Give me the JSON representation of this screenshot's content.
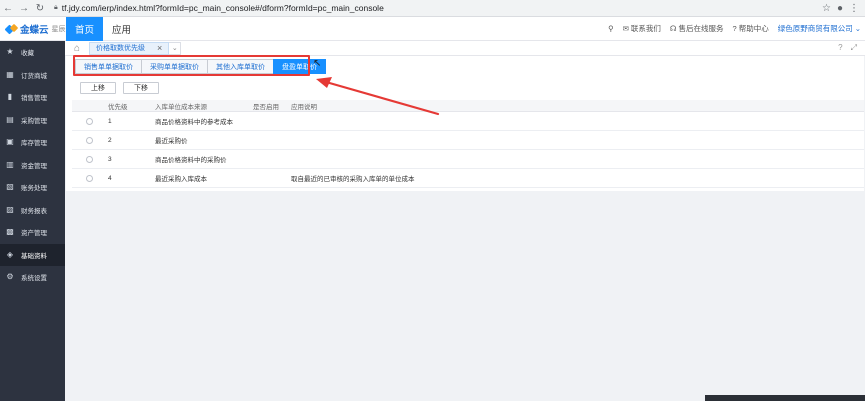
{
  "browser": {
    "url": "tf.jdy.com/ierp/index.html?formId=pc_main_console#/dform?formId=pc_main_console"
  },
  "header": {
    "logo_text": "金蝶云",
    "logo_sub": "星辰",
    "tabs": [
      {
        "label": "首页",
        "active": true
      },
      {
        "label": "应用",
        "active": false
      }
    ],
    "links": {
      "contact": "联系我们",
      "service": "售后在线服务",
      "help": "帮助中心",
      "company": "绿色原野商贸有限公司"
    }
  },
  "sidebar": {
    "items": [
      {
        "label": "收藏",
        "icon": "star-icon"
      },
      {
        "label": "订货商城",
        "icon": "mall-icon"
      },
      {
        "label": "销售管理",
        "icon": "bar-chart-icon"
      },
      {
        "label": "采购管理",
        "icon": "purchase-icon"
      },
      {
        "label": "库存管理",
        "icon": "inventory-icon"
      },
      {
        "label": "资金管理",
        "icon": "wallet-icon"
      },
      {
        "label": "账务处理",
        "icon": "ledger-icon"
      },
      {
        "label": "财务报表",
        "icon": "report-icon"
      },
      {
        "label": "资产管理",
        "icon": "asset-icon"
      },
      {
        "label": "基础资料",
        "icon": "layers-icon",
        "active": true
      },
      {
        "label": "系统设置",
        "icon": "gear-icon"
      }
    ]
  },
  "page_tab": {
    "label": "价格取数优先级"
  },
  "sub_tabs": [
    {
      "label": "销售单单据取价",
      "active": false
    },
    {
      "label": "采购单单据取价",
      "active": false
    },
    {
      "label": "其他入库单取价",
      "active": false
    },
    {
      "label": "盘盈单取价",
      "active": true
    }
  ],
  "actions": {
    "up": "上移",
    "down": "下移"
  },
  "grid": {
    "headers": {
      "priority": "优先级",
      "source": "入库单位成本来源",
      "enabled": "是否启用",
      "desc": "应用说明"
    },
    "rows": [
      {
        "priority": "1",
        "source": "商品价格资料中的参考成本",
        "enabled": true,
        "desc": ""
      },
      {
        "priority": "2",
        "source": "最近采购价",
        "enabled": true,
        "desc": ""
      },
      {
        "priority": "3",
        "source": "商品价格资料中的采购价",
        "enabled": true,
        "desc": ""
      },
      {
        "priority": "4",
        "source": "最近采购入库成本",
        "enabled": false,
        "desc": "取自最近的已审核的采购入库单的单位成本"
      }
    ]
  },
  "colors": {
    "accent": "#1890ff",
    "annotation": "#e53935",
    "toggle_on": "#52b13c",
    "sidebar": "#2d3340"
  }
}
